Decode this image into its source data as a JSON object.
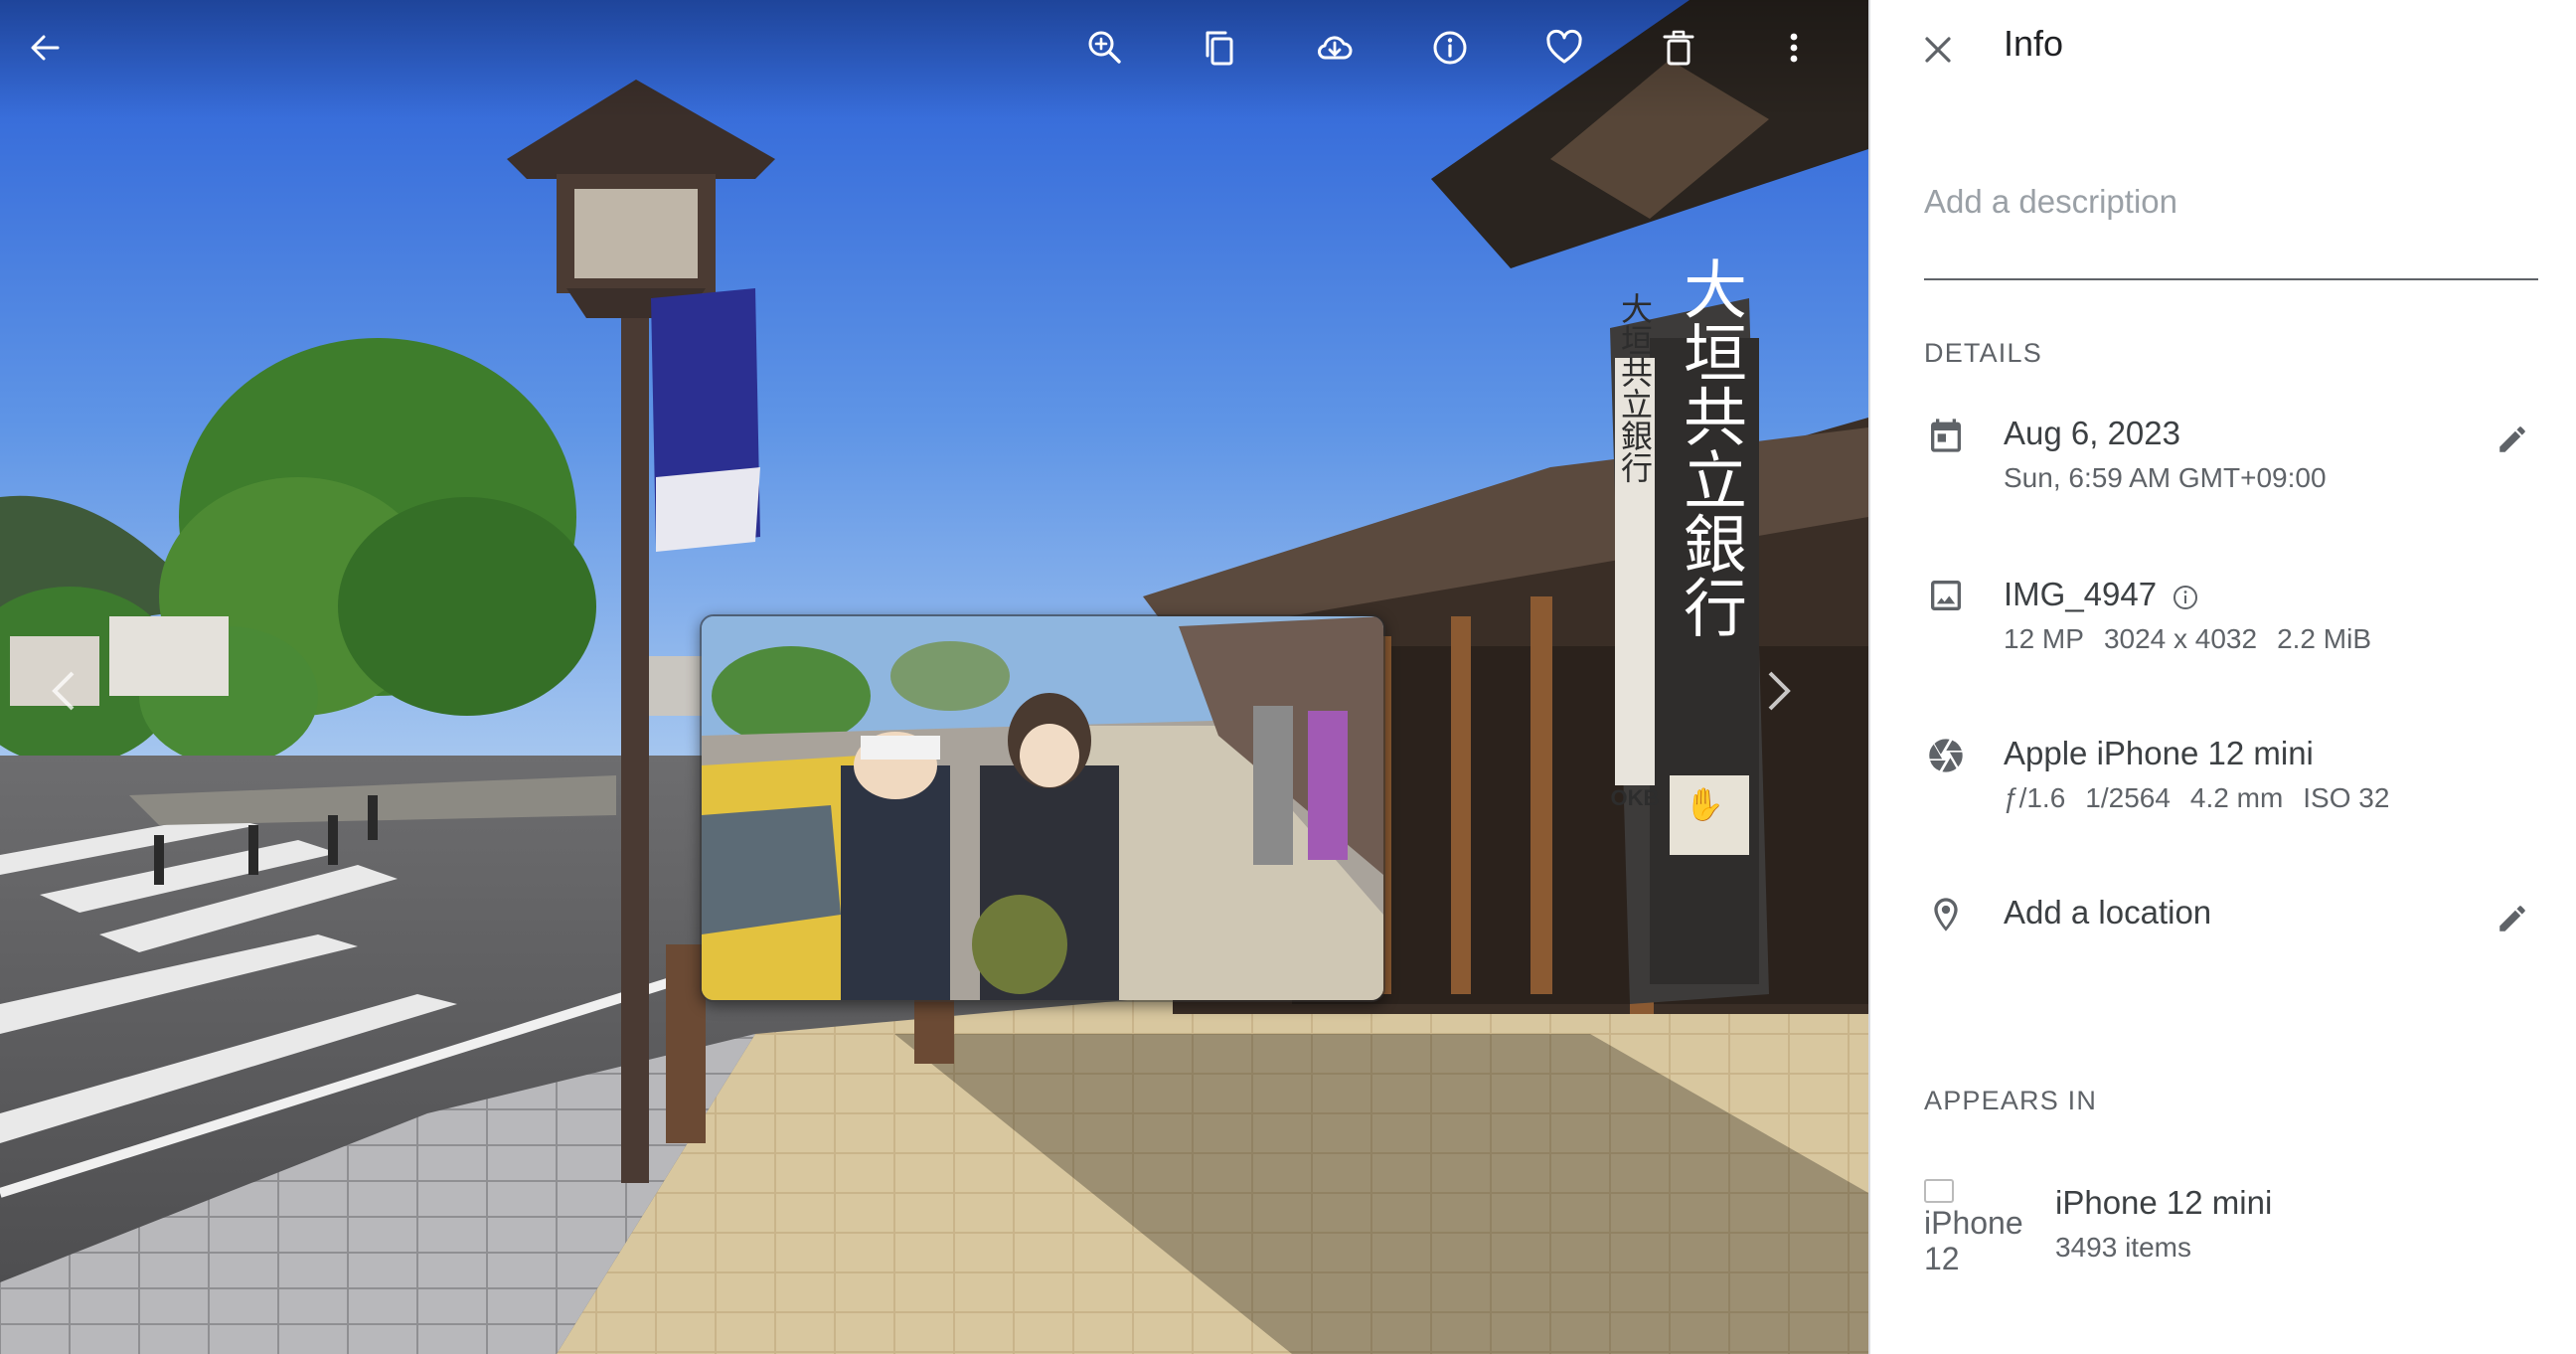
{
  "toolbar": {
    "back_icon": "arrow-back-icon",
    "zoom_icon": "zoom-in-icon",
    "copy_icon": "copy-icon",
    "download_icon": "cloud-download-icon",
    "info_icon": "info-icon",
    "favorite_icon": "heart-icon",
    "delete_icon": "trash-icon",
    "more_icon": "more-vert-icon"
  },
  "photo": {
    "sign_main": "大垣共立銀行",
    "sign_side": "大垣共立銀行",
    "sign_okb": "OKB"
  },
  "info": {
    "title": "Info",
    "description_placeholder": "Add a description",
    "details_header": "DETAILS",
    "date": {
      "primary": "Aug 6, 2023",
      "secondary": "Sun, 6:59 AM GMT+09:00"
    },
    "file": {
      "name": "IMG_4947",
      "megapixels": "12 MP",
      "resolution": "3024 x 4032",
      "size": "2.2 MiB"
    },
    "camera": {
      "model": "Apple iPhone 12 mini",
      "aperture": "ƒ/1.6",
      "shutter": "1/2564",
      "focal_length": "4.2 mm",
      "iso": "ISO 32"
    },
    "location": {
      "placeholder": "Add a location"
    },
    "appears_in_header": "APPEARS IN",
    "album": {
      "thumb_alt": "iPhone 12",
      "name": "iPhone 12 mini",
      "count": "3493 items"
    }
  },
  "colors": {
    "sky_top": "#2d62d8",
    "sky_bottom": "#8db8ee",
    "panel_text": "#3c4043",
    "panel_secondary": "#5f6368",
    "placeholder": "#9aa0a6"
  }
}
